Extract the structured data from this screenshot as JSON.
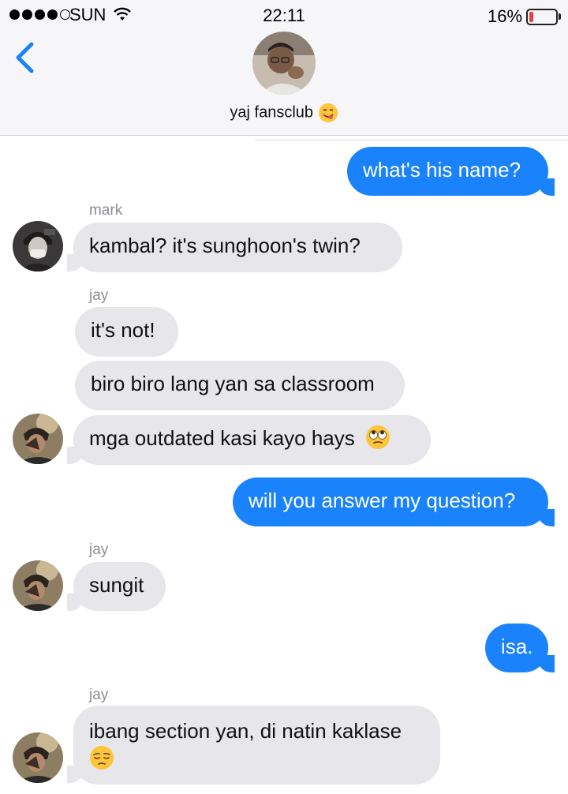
{
  "status_bar": {
    "carrier": "SUN",
    "time": "22:11",
    "battery_percent": "16%",
    "battery_level": 0.16,
    "battery_color": "#e8423a",
    "signal_bars_filled": 4,
    "signal_bars_total": 5
  },
  "header": {
    "group_name": "yaj fansclub",
    "group_emoji": "yum-face-icon",
    "back_icon": "chevron-left-icon"
  },
  "colors": {
    "accent": "#1a82fb",
    "incoming_bubble": "#e6e6eb"
  },
  "messages": [
    {
      "direction": "outgoing",
      "text": "what's his name?"
    },
    {
      "direction": "incoming",
      "sender": "mark",
      "text": "kambal? it's sunghoon's twin?"
    },
    {
      "direction": "incoming",
      "sender": "jay",
      "text": "it's not!"
    },
    {
      "direction": "incoming",
      "text": "biro biro lang yan sa classroom"
    },
    {
      "direction": "incoming",
      "text": "mga outdated kasi kayo hays",
      "emoji": "eye-roll-face-icon"
    },
    {
      "direction": "outgoing",
      "text": "will you answer my question?"
    },
    {
      "direction": "incoming",
      "sender": "jay",
      "text": "sungit"
    },
    {
      "direction": "outgoing",
      "text": "isa."
    },
    {
      "direction": "incoming",
      "sender": "jay",
      "text": "ibang section yan, di natin kaklase",
      "emoji": "pensive-face-icon"
    }
  ]
}
